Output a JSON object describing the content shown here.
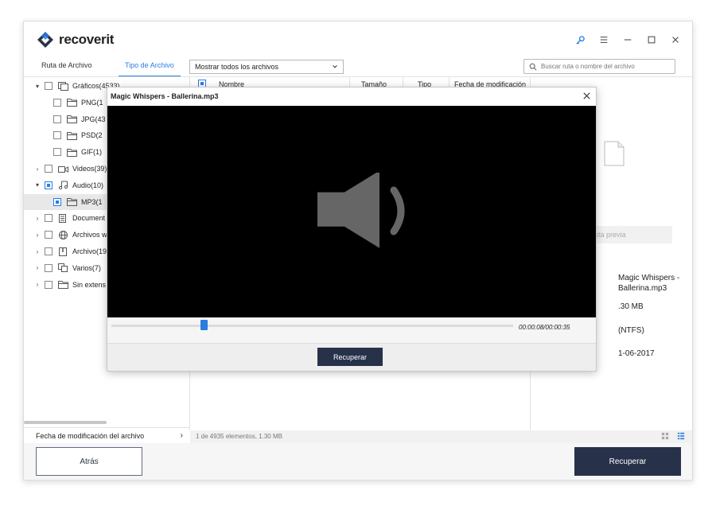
{
  "app": {
    "name": "recoverit"
  },
  "tabs": [
    {
      "label": "Ruta de Archivo"
    },
    {
      "label": "Tipo de Archivo"
    }
  ],
  "filter": {
    "value": "Mostrar todos los archivos"
  },
  "search": {
    "placeholder": "Buscar ruta o nombre del archivo"
  },
  "columns": [
    "Nombre",
    "Tamaño",
    "Tipo",
    "Fecha de modificación"
  ],
  "tree": [
    {
      "label": "Gráficos(4533)",
      "level": 0,
      "caret": "▾",
      "checked": false,
      "icon": "image-icon"
    },
    {
      "label": "PNG(1",
      "level": 1,
      "caret": "",
      "checked": false,
      "icon": "folder-icon"
    },
    {
      "label": "JPG(43",
      "level": 1,
      "caret": "",
      "checked": false,
      "icon": "folder-icon"
    },
    {
      "label": "PSD(2",
      "level": 1,
      "caret": "",
      "checked": false,
      "icon": "folder-icon"
    },
    {
      "label": "GIF(1)",
      "level": 1,
      "caret": "",
      "checked": false,
      "icon": "folder-icon"
    },
    {
      "label": "Videos(39)",
      "level": 0,
      "caret": "›",
      "checked": false,
      "icon": "video-icon"
    },
    {
      "label": "Audio(10)",
      "level": 0,
      "caret": "▾",
      "checked": true,
      "icon": "music-icon"
    },
    {
      "label": "MP3(1",
      "level": 1,
      "caret": "",
      "checked": true,
      "icon": "folder-icon",
      "selected": true
    },
    {
      "label": "Document",
      "level": 0,
      "caret": "›",
      "checked": false,
      "icon": "document-icon"
    },
    {
      "label": "Archivos w",
      "level": 0,
      "caret": "›",
      "checked": false,
      "icon": "globe-icon"
    },
    {
      "label": "Archivo(19",
      "level": 0,
      "caret": "›",
      "checked": false,
      "icon": "archive-icon"
    },
    {
      "label": "Varios(7)",
      "level": 0,
      "caret": "›",
      "checked": false,
      "icon": "copy-icon"
    },
    {
      "label": "Sin extens",
      "level": 0,
      "caret": "›",
      "checked": false,
      "icon": "folder-icon"
    }
  ],
  "date_filter": {
    "label": "Fecha de modificación del archivo"
  },
  "status": {
    "text": "1 de 4935 elementos, 1.30  MB"
  },
  "preview": {
    "label": "ista previa",
    "name_line1": "Magic Whispers -",
    "name_line2": "Ballerina.mp3",
    "size": ".30  MB",
    "fs": "(NTFS)",
    "date": "1-06-2017"
  },
  "footer": {
    "back_label": "Atrás",
    "recover_label": "Recuperar"
  },
  "modal": {
    "title": "Magic Whispers - Ballerina.mp3",
    "time": "00:00:08/00:00:35",
    "progress": 0.23,
    "recover_label": "Recuperar"
  },
  "colors": {
    "accent": "#2a7de1",
    "primary_button": "#27324a"
  }
}
